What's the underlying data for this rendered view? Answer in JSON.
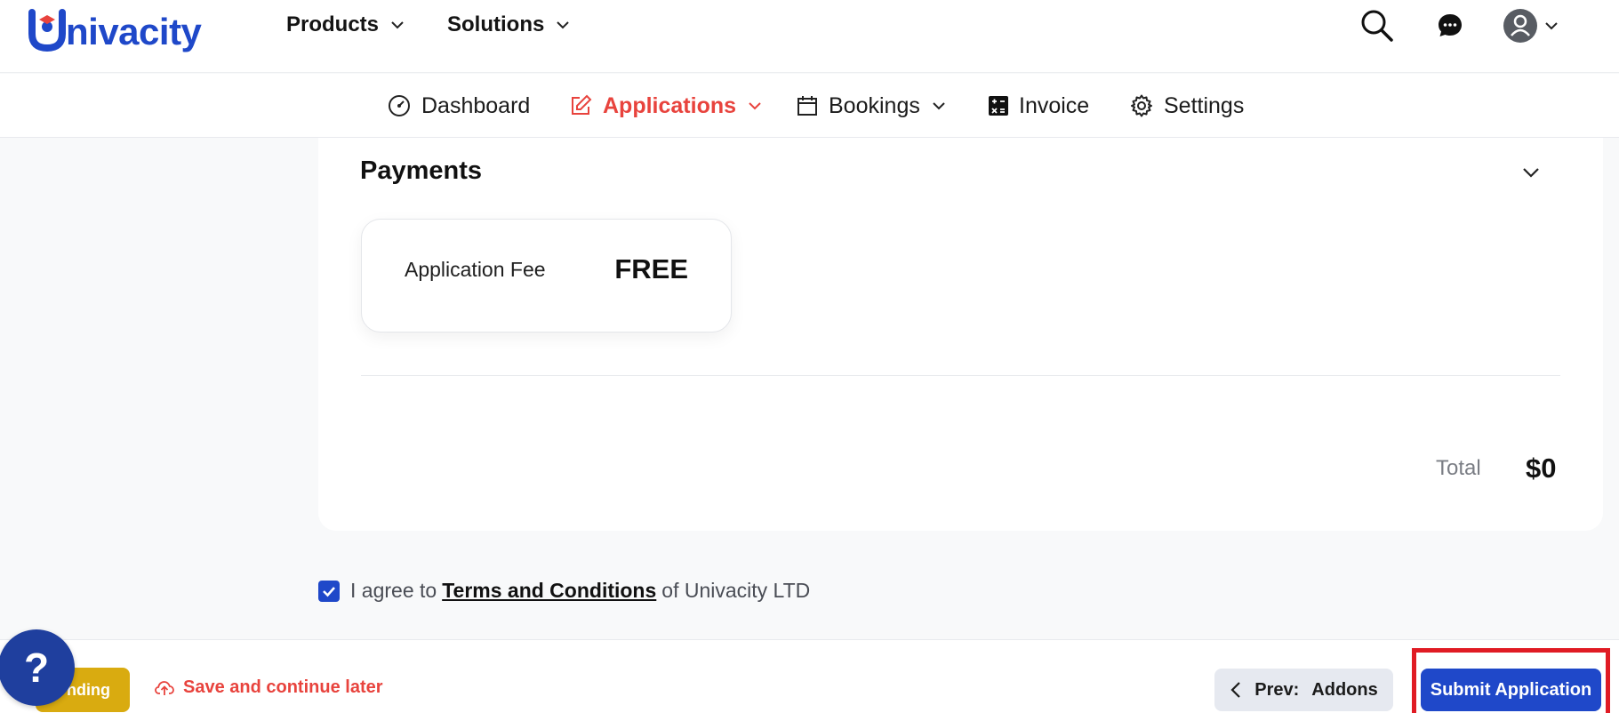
{
  "brand": {
    "name_rest": "nivacity",
    "color": "#1f48c9"
  },
  "topnav": {
    "items": [
      {
        "label": "Products"
      },
      {
        "label": "Solutions"
      }
    ]
  },
  "subnav": {
    "items": [
      {
        "label": "Dashboard",
        "icon": "gauge-icon"
      },
      {
        "label": "Applications",
        "icon": "edit-icon",
        "active": true
      },
      {
        "label": "Bookings",
        "icon": "calendar-icon"
      },
      {
        "label": "Invoice",
        "icon": "calculator-icon"
      },
      {
        "label": "Settings",
        "icon": "gear-icon"
      }
    ],
    "active_color": "#e8433d"
  },
  "payments": {
    "title": "Payments",
    "fee_label": "Application Fee",
    "fee_value": "FREE",
    "total_label": "Total",
    "total_value": "$0"
  },
  "agreement": {
    "checked": true,
    "prefix": "I agree to",
    "link": "Terms and Conditions",
    "suffix": "of Univacity LTD"
  },
  "footer": {
    "status_badge": "nding",
    "help_label": "?",
    "save_later": "Save and continue later",
    "prev_label": "Prev:",
    "prev_target": "Addons",
    "submit_label": "Submit Application"
  }
}
